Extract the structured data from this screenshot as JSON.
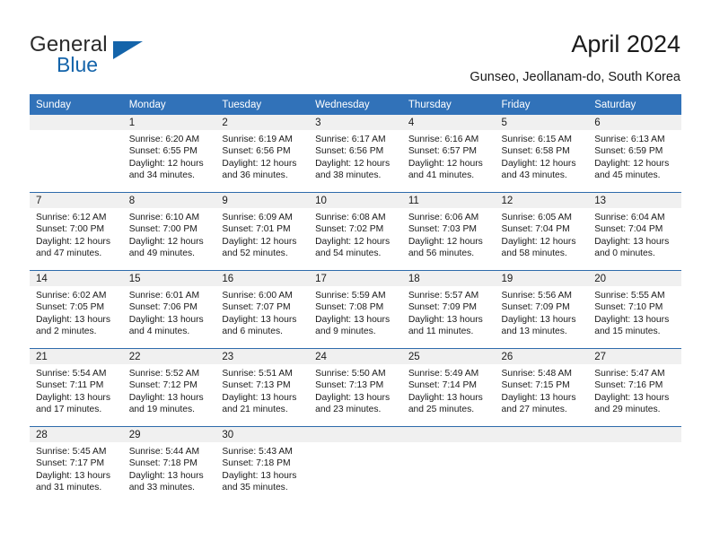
{
  "brand": {
    "name_part1": "General",
    "name_part2": "Blue"
  },
  "header": {
    "title": "April 2024",
    "subtitle": "Gunseo, Jeollanam-do, South Korea"
  },
  "colors": {
    "header_blue": "#3172b9",
    "rule_blue": "#2e6bab",
    "daynum_band": "#f0f0f0",
    "logo_blue": "#1464aa",
    "text": "#1a1a1a"
  },
  "weekday_headers": [
    "Sunday",
    "Monday",
    "Tuesday",
    "Wednesday",
    "Thursday",
    "Friday",
    "Saturday"
  ],
  "weeks": [
    [
      {
        "day": "",
        "lines": []
      },
      {
        "day": "1",
        "lines": [
          "Sunrise: 6:20 AM",
          "Sunset: 6:55 PM",
          "Daylight: 12 hours",
          "and 34 minutes."
        ]
      },
      {
        "day": "2",
        "lines": [
          "Sunrise: 6:19 AM",
          "Sunset: 6:56 PM",
          "Daylight: 12 hours",
          "and 36 minutes."
        ]
      },
      {
        "day": "3",
        "lines": [
          "Sunrise: 6:17 AM",
          "Sunset: 6:56 PM",
          "Daylight: 12 hours",
          "and 38 minutes."
        ]
      },
      {
        "day": "4",
        "lines": [
          "Sunrise: 6:16 AM",
          "Sunset: 6:57 PM",
          "Daylight: 12 hours",
          "and 41 minutes."
        ]
      },
      {
        "day": "5",
        "lines": [
          "Sunrise: 6:15 AM",
          "Sunset: 6:58 PM",
          "Daylight: 12 hours",
          "and 43 minutes."
        ]
      },
      {
        "day": "6",
        "lines": [
          "Sunrise: 6:13 AM",
          "Sunset: 6:59 PM",
          "Daylight: 12 hours",
          "and 45 minutes."
        ]
      }
    ],
    [
      {
        "day": "7",
        "lines": [
          "Sunrise: 6:12 AM",
          "Sunset: 7:00 PM",
          "Daylight: 12 hours",
          "and 47 minutes."
        ]
      },
      {
        "day": "8",
        "lines": [
          "Sunrise: 6:10 AM",
          "Sunset: 7:00 PM",
          "Daylight: 12 hours",
          "and 49 minutes."
        ]
      },
      {
        "day": "9",
        "lines": [
          "Sunrise: 6:09 AM",
          "Sunset: 7:01 PM",
          "Daylight: 12 hours",
          "and 52 minutes."
        ]
      },
      {
        "day": "10",
        "lines": [
          "Sunrise: 6:08 AM",
          "Sunset: 7:02 PM",
          "Daylight: 12 hours",
          "and 54 minutes."
        ]
      },
      {
        "day": "11",
        "lines": [
          "Sunrise: 6:06 AM",
          "Sunset: 7:03 PM",
          "Daylight: 12 hours",
          "and 56 minutes."
        ]
      },
      {
        "day": "12",
        "lines": [
          "Sunrise: 6:05 AM",
          "Sunset: 7:04 PM",
          "Daylight: 12 hours",
          "and 58 minutes."
        ]
      },
      {
        "day": "13",
        "lines": [
          "Sunrise: 6:04 AM",
          "Sunset: 7:04 PM",
          "Daylight: 13 hours",
          "and 0 minutes."
        ]
      }
    ],
    [
      {
        "day": "14",
        "lines": [
          "Sunrise: 6:02 AM",
          "Sunset: 7:05 PM",
          "Daylight: 13 hours",
          "and 2 minutes."
        ]
      },
      {
        "day": "15",
        "lines": [
          "Sunrise: 6:01 AM",
          "Sunset: 7:06 PM",
          "Daylight: 13 hours",
          "and 4 minutes."
        ]
      },
      {
        "day": "16",
        "lines": [
          "Sunrise: 6:00 AM",
          "Sunset: 7:07 PM",
          "Daylight: 13 hours",
          "and 6 minutes."
        ]
      },
      {
        "day": "17",
        "lines": [
          "Sunrise: 5:59 AM",
          "Sunset: 7:08 PM",
          "Daylight: 13 hours",
          "and 9 minutes."
        ]
      },
      {
        "day": "18",
        "lines": [
          "Sunrise: 5:57 AM",
          "Sunset: 7:09 PM",
          "Daylight: 13 hours",
          "and 11 minutes."
        ]
      },
      {
        "day": "19",
        "lines": [
          "Sunrise: 5:56 AM",
          "Sunset: 7:09 PM",
          "Daylight: 13 hours",
          "and 13 minutes."
        ]
      },
      {
        "day": "20",
        "lines": [
          "Sunrise: 5:55 AM",
          "Sunset: 7:10 PM",
          "Daylight: 13 hours",
          "and 15 minutes."
        ]
      }
    ],
    [
      {
        "day": "21",
        "lines": [
          "Sunrise: 5:54 AM",
          "Sunset: 7:11 PM",
          "Daylight: 13 hours",
          "and 17 minutes."
        ]
      },
      {
        "day": "22",
        "lines": [
          "Sunrise: 5:52 AM",
          "Sunset: 7:12 PM",
          "Daylight: 13 hours",
          "and 19 minutes."
        ]
      },
      {
        "day": "23",
        "lines": [
          "Sunrise: 5:51 AM",
          "Sunset: 7:13 PM",
          "Daylight: 13 hours",
          "and 21 minutes."
        ]
      },
      {
        "day": "24",
        "lines": [
          "Sunrise: 5:50 AM",
          "Sunset: 7:13 PM",
          "Daylight: 13 hours",
          "and 23 minutes."
        ]
      },
      {
        "day": "25",
        "lines": [
          "Sunrise: 5:49 AM",
          "Sunset: 7:14 PM",
          "Daylight: 13 hours",
          "and 25 minutes."
        ]
      },
      {
        "day": "26",
        "lines": [
          "Sunrise: 5:48 AM",
          "Sunset: 7:15 PM",
          "Daylight: 13 hours",
          "and 27 minutes."
        ]
      },
      {
        "day": "27",
        "lines": [
          "Sunrise: 5:47 AM",
          "Sunset: 7:16 PM",
          "Daylight: 13 hours",
          "and 29 minutes."
        ]
      }
    ],
    [
      {
        "day": "28",
        "lines": [
          "Sunrise: 5:45 AM",
          "Sunset: 7:17 PM",
          "Daylight: 13 hours",
          "and 31 minutes."
        ]
      },
      {
        "day": "29",
        "lines": [
          "Sunrise: 5:44 AM",
          "Sunset: 7:18 PM",
          "Daylight: 13 hours",
          "and 33 minutes."
        ]
      },
      {
        "day": "30",
        "lines": [
          "Sunrise: 5:43 AM",
          "Sunset: 7:18 PM",
          "Daylight: 13 hours",
          "and 35 minutes."
        ]
      },
      {
        "day": "",
        "lines": []
      },
      {
        "day": "",
        "lines": []
      },
      {
        "day": "",
        "lines": []
      },
      {
        "day": "",
        "lines": []
      }
    ]
  ]
}
